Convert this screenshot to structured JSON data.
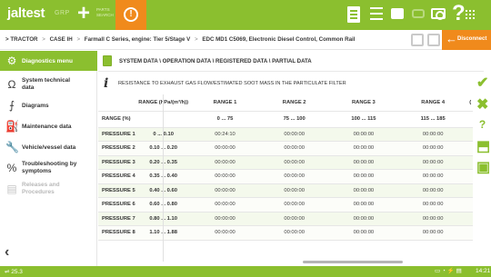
{
  "app": {
    "logo": "jaltest",
    "logo_tagline": "BY COJALI",
    "group_label": "GRP",
    "parts_label": "PARTS SEARCH",
    "help_symbol": "?",
    "accent_color": "#8bbf2f",
    "warning_color": "#f08a1c",
    "window_min": "–",
    "window_max": "□",
    "window_close": "✕"
  },
  "breadcrumb": {
    "items": [
      "TRACTOR",
      "CASE IH",
      "Farmall C Series, engine: Tier 5/Stage V",
      "EDC MD1 C5069, Electronic Diesel Control, Common Rail"
    ],
    "separator": ">"
  },
  "disconnect": {
    "label": "Disconnect",
    "arrow": "←"
  },
  "sidebar": {
    "items": [
      {
        "label": "Diagnostics menu",
        "icon": "scan-tool-icon",
        "glyph": "⚙",
        "active": true,
        "disabled": false
      },
      {
        "label": "System technical data",
        "icon": "omega-icon",
        "glyph": "Ω",
        "active": false,
        "disabled": false
      },
      {
        "label": "Diagrams",
        "icon": "diagram-icon",
        "glyph": "⨍",
        "active": false,
        "disabled": false
      },
      {
        "label": "Maintenance data",
        "icon": "oil-can-icon",
        "glyph": "⛽",
        "active": false,
        "disabled": false
      },
      {
        "label": "Vehicle/vessel data",
        "icon": "wrench-icon",
        "glyph": "🔧",
        "active": false,
        "disabled": false
      },
      {
        "label": "Troubleshooting by symptoms",
        "icon": "percent-icon",
        "glyph": "%",
        "active": false,
        "disabled": false
      },
      {
        "label": "Releases and Procedures",
        "icon": "stack-icon",
        "glyph": "▤",
        "active": false,
        "disabled": true
      }
    ],
    "back": "‹"
  },
  "header": {
    "title": "SYSTEM DATA \\ OPERATION DATA \\ REGISTERED DATA \\ PARTIAL DATA"
  },
  "info": {
    "text": "RESISTANCE TO EXHAUST GAS FLOW/ESTIMATED SOOT MASS IN THE PARTICULATE FILTER"
  },
  "table": {
    "header": [
      "",
      "RANGE (hPa/(m³/h))",
      "RANGE 1",
      "RANGE 2",
      "RANGE 3",
      "RANGE 4"
    ],
    "subheader": [
      "RANGE (%)",
      "",
      "0 ... 75",
      "75 ... 100",
      "100 ... 115",
      "115 ... 185"
    ],
    "rows": [
      {
        "label": "PRESSURE 1",
        "range": "0 ... 0.10",
        "values": [
          "00:24:10",
          "00:00:00",
          "00:00:00",
          "00:00:00"
        ]
      },
      {
        "label": "PRESSURE 2",
        "range": "0.10 ... 0.20",
        "values": [
          "00:00:00",
          "00:00:00",
          "00:00:00",
          "00:00:00"
        ]
      },
      {
        "label": "PRESSURE 3",
        "range": "0.20 ... 0.35",
        "values": [
          "00:00:00",
          "00:00:00",
          "00:00:00",
          "00:00:00"
        ]
      },
      {
        "label": "PRESSURE 4",
        "range": "0.35 ... 0.40",
        "values": [
          "00:00:00",
          "00:00:00",
          "00:00:00",
          "00:00:00"
        ]
      },
      {
        "label": "PRESSURE 5",
        "range": "0.40 ... 0.60",
        "values": [
          "00:00:00",
          "00:00:00",
          "00:00:00",
          "00:00:00"
        ]
      },
      {
        "label": "PRESSURE 6",
        "range": "0.60 ... 0.80",
        "values": [
          "00:00:00",
          "00:00:00",
          "00:00:00",
          "00:00:00"
        ]
      },
      {
        "label": "PRESSURE 7",
        "range": "0.80 ... 1.10",
        "values": [
          "00:00:00",
          "00:00:00",
          "00:00:00",
          "00:00:00"
        ]
      },
      {
        "label": "PRESSURE 8",
        "range": "1.10 ... 1.88",
        "values": [
          "00:00:00",
          "00:00:00",
          "00:00:00",
          "00:00:00"
        ]
      }
    ]
  },
  "actions": [
    {
      "name": "check-icon",
      "glyph": "✔",
      "color": "#8bbf2f"
    },
    {
      "name": "close-icon",
      "glyph": "✖",
      "color": "#8bbf2f"
    },
    {
      "name": "help-icon",
      "glyph": "?",
      "color": "#8bbf2f"
    },
    {
      "name": "export-icon",
      "glyph": "⬒",
      "color": "#8bbf2f"
    },
    {
      "name": "pages-icon",
      "glyph": "▣",
      "color": "#8bbf2f"
    }
  ],
  "status": {
    "voltage": "25.3",
    "time": "14:21"
  }
}
